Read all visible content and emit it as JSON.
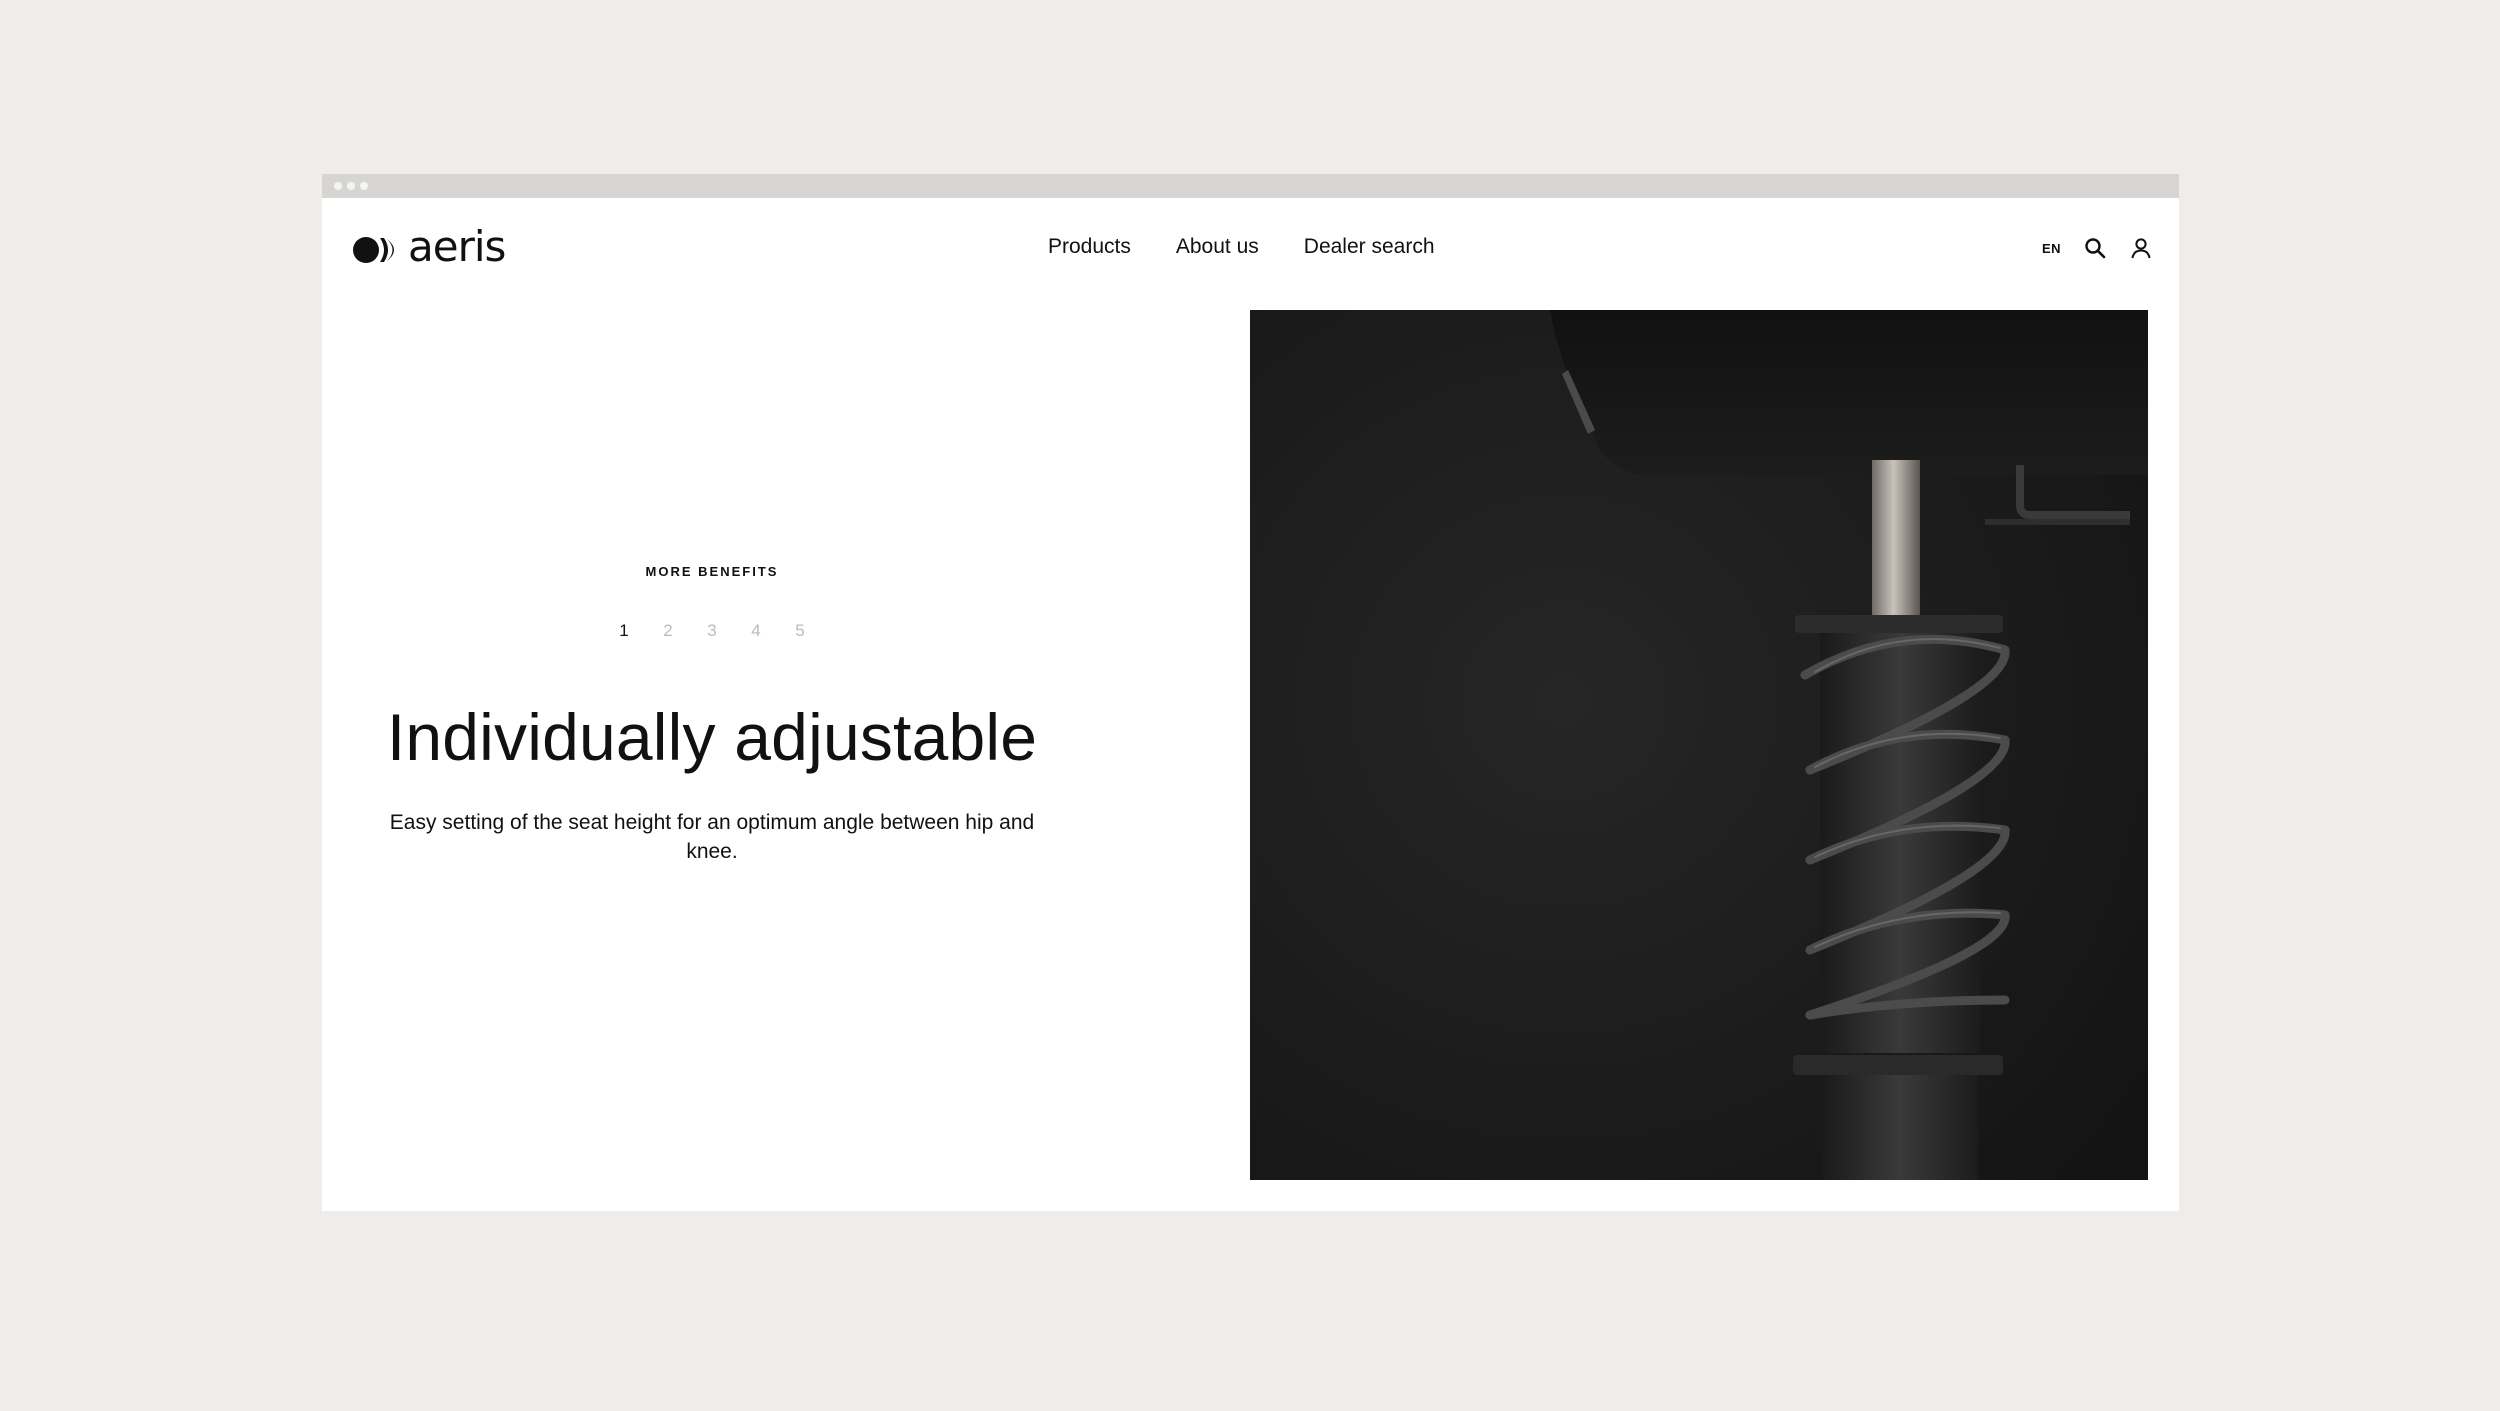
{
  "brand": {
    "name": "aeris",
    "logo_icon": "aeris-logo-mark"
  },
  "nav": {
    "items": [
      {
        "label": "Products"
      },
      {
        "label": "About us"
      },
      {
        "label": "Dealer search"
      }
    ]
  },
  "utilities": {
    "language": "EN",
    "search_icon": "search-icon",
    "account_icon": "user-icon"
  },
  "benefits": {
    "eyebrow": "MORE BENEFITS",
    "pager": [
      "1",
      "2",
      "3",
      "4",
      "5"
    ],
    "active_page": "1",
    "title": "Individually adjustable",
    "description": "Easy setting of the seat height for an optimum angle between hip and knee."
  },
  "colors": {
    "page_background": "#eeede9",
    "window_background": "#ffffff",
    "text": "#111111",
    "inactive_pager": "#bbbbbb",
    "hero_background": "#1b1b1b"
  }
}
